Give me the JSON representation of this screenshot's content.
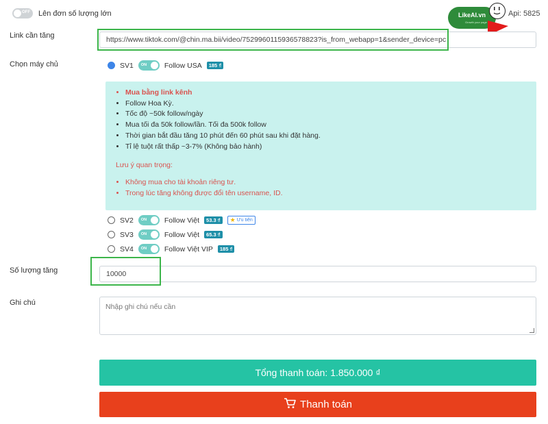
{
  "bulk": {
    "toggle_state": "OFF",
    "label": "Lên đơn số lượng lớn"
  },
  "logo": {
    "name": "LikeAI.vn",
    "tagline": "Growth your page"
  },
  "api": {
    "label": "Api: 5825"
  },
  "link": {
    "label": "Link cần tăng",
    "value": "https://www.tiktok.com/@chin.ma.bii/video/7529960115936578823?is_from_webapp=1&sender_device=pc"
  },
  "server": {
    "label": "Chọn máy chủ",
    "options": [
      {
        "id": "SV1",
        "toggle": "ON",
        "name": "Follow USA",
        "price": "185 ₫",
        "selected": true
      },
      {
        "id": "SV2",
        "toggle": "ON",
        "name": "Follow Việt",
        "price": "53.3 ₫",
        "priority": "Ưu tiên",
        "selected": false
      },
      {
        "id": "SV3",
        "toggle": "ON",
        "name": "Follow Việt",
        "price": "65.3 ₫",
        "selected": false
      },
      {
        "id": "SV4",
        "toggle": "ON",
        "name": "Follow Việt VIP",
        "price": "185 ₫",
        "selected": false
      }
    ]
  },
  "info": {
    "items": [
      "Mua bằng link kênh",
      "Follow Hoa Kỳ.",
      "Tốc độ ~50k follow/ngày",
      "Mua tối đa 50k follow/lần. Tối đa 500k follow",
      "Thời gian bắt đầu tăng 10 phút đến 60 phút sau khi đặt hàng.",
      "Tỉ lệ tuột rất thấp ~3-7% (Không bảo hành)"
    ],
    "note_title": "Lưu ý quan trọng:",
    "notes": [
      "Không mua cho tài khoản riêng tư.",
      "Trong lúc tăng không được đổi tên username, ID."
    ]
  },
  "quantity": {
    "label": "Số lượng tăng",
    "value": "10000"
  },
  "note": {
    "label": "Ghi chú",
    "placeholder": "Nhập ghi chú nếu cần"
  },
  "total": {
    "label": "Tổng thanh toán: 1.850.000  ₫"
  },
  "pay": {
    "label": "Thanh toán"
  },
  "colors": {
    "accent": "#25c3a4",
    "pay": "#e8401c",
    "highlight": "#3cb54a",
    "info_bg": "#c9f2ee"
  }
}
